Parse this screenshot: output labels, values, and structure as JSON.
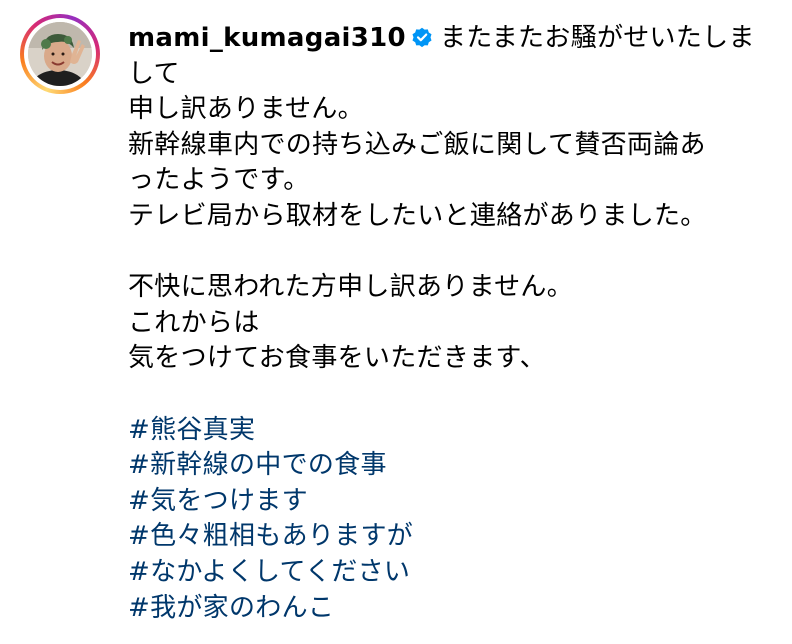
{
  "post": {
    "username": "mami_kumagai310",
    "caption_first": "またまたお騒がせいたしま",
    "caption_lines": [
      "して",
      "申し訳ありません。",
      "新幹線車内での持ち込みご飯に関して賛否両論あ",
      "ったようです。",
      "テレビ局から取材をしたいと連絡がありました。",
      "",
      "不快に思われた方申し訳ありません。",
      "これからは",
      "気をつけてお食事をいただきます、",
      ""
    ],
    "hashtags": [
      "#熊谷真実",
      "#新幹線の中での食事",
      "#気をつけます",
      "#色々粗相もありますが",
      "#なかよくしてください",
      "#我が家のわんこ"
    ]
  },
  "icons": {
    "avatar": "profile-photo",
    "verified": "verified-badge-icon"
  },
  "colors": {
    "text": "#000000",
    "hashtag": "#00376b",
    "verified": "#0095f6",
    "ring_start": "#feda75",
    "ring_end": "#d62976"
  }
}
